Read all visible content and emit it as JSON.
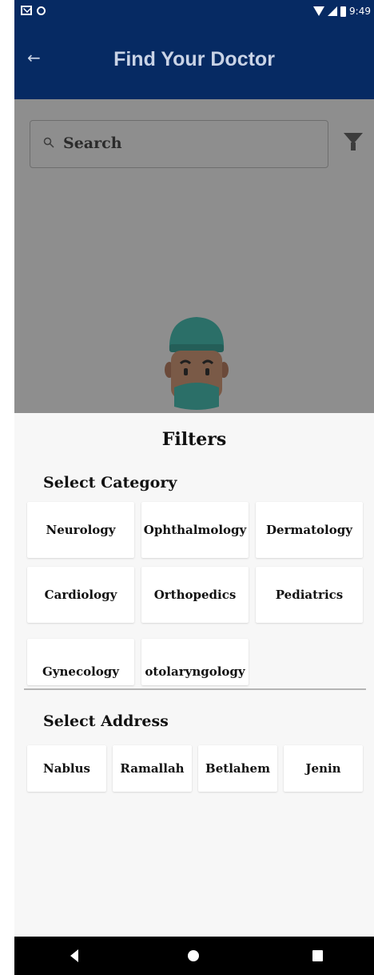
{
  "status_bar": {
    "time": "9:49",
    "icons": [
      "mail-icon",
      "circle-icon",
      "wifi-icon",
      "signal-icon",
      "battery-icon"
    ]
  },
  "app_bar": {
    "title": "Find Your Doctor",
    "back_icon": "arrow-left-icon"
  },
  "search": {
    "value": "Search",
    "icon": "search-icon",
    "filter_icon": "filter-icon"
  },
  "filters": {
    "title": "Filters",
    "category_title": "Select Category",
    "categories": [
      "Neurology",
      "Ophthalmology",
      "Dermatology",
      "Cardiology",
      "Orthopedics",
      "Pediatrics",
      "Gynecology",
      "otolaryngology"
    ],
    "address_title": "Select Address",
    "addresses": [
      "Nablus",
      "Ramallah",
      "Betlahem",
      "Jenin"
    ]
  },
  "nav_bar": {
    "icons": [
      "nav-back-icon",
      "nav-home-icon",
      "nav-recent-icon"
    ]
  },
  "colors": {
    "primary": "#062a63",
    "overlay": "#8e8e8e",
    "sheet": "#f7f7f7"
  }
}
